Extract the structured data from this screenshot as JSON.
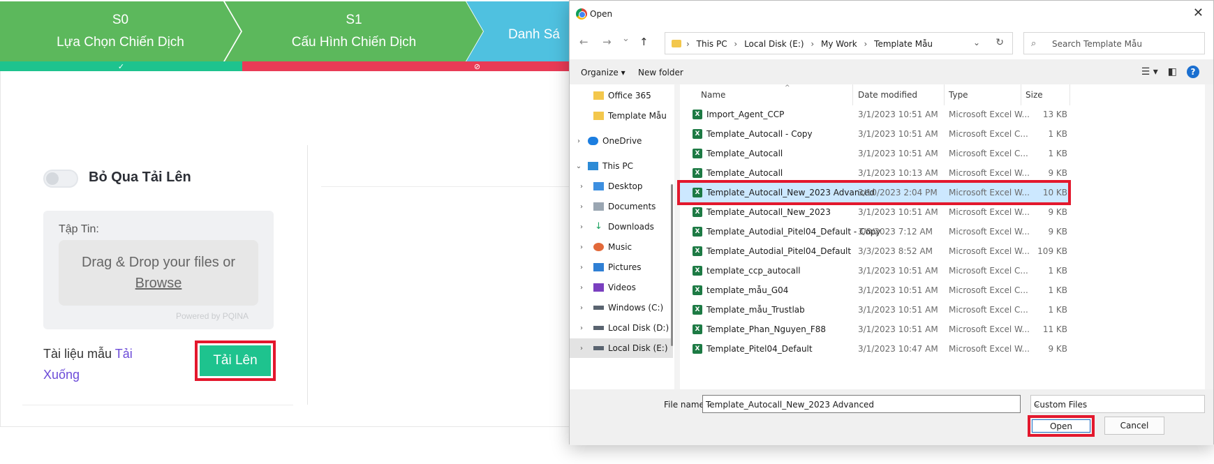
{
  "wizard": {
    "steps": [
      {
        "code": "S0",
        "label": "Lựa Chọn Chiến Dịch"
      },
      {
        "code": "S1",
        "label": "Cấu Hình Chiến Dịch"
      },
      {
        "code": "",
        "label": "Danh Sá"
      }
    ],
    "progress_ok_icon": "✓",
    "progress_bad_icon": "⊘",
    "colors": {
      "green": "#5cb85c",
      "blue": "#4fc1e0",
      "ok_bar": "#1ec38e",
      "bad_bar": "#e93b56"
    }
  },
  "upload_panel": {
    "skip_label": "Bỏ Qua Tải Lên",
    "file_label": "Tập Tin:",
    "drop_text": "Drag & Drop your files or",
    "browse": "Browse",
    "powered": "Powered by PQINA",
    "sample_text": "Tài liệu mẫu",
    "sample_link_1": "Tải",
    "sample_link_2": "Xuống",
    "upload_button": "Tải Lên"
  },
  "dialog": {
    "title": "Open",
    "close": "✕",
    "nav": {
      "back": "←",
      "forward": "→",
      "recent": "⌄",
      "up": "↑"
    },
    "breadcrumbs": [
      "This PC",
      "Local Disk (E:)",
      "My Work",
      "Template Mẫu"
    ],
    "search_placeholder": "Search Template Mẫu",
    "toolbar": {
      "organize": "Organize ▾",
      "new_folder": "New folder"
    },
    "nav_pane": [
      {
        "label": "Office 365",
        "icon": "folder-icon"
      },
      {
        "label": "Template Mẫu",
        "icon": "folder-icon"
      },
      {
        "label": "OneDrive",
        "icon": "cloud-icon"
      },
      {
        "label": "This PC",
        "icon": "pc-icon"
      },
      {
        "label": "Desktop",
        "icon": "desktop-icon"
      },
      {
        "label": "Documents",
        "icon": "documents-icon"
      },
      {
        "label": "Downloads",
        "icon": "download-icon"
      },
      {
        "label": "Music",
        "icon": "music-icon"
      },
      {
        "label": "Pictures",
        "icon": "pictures-icon"
      },
      {
        "label": "Videos",
        "icon": "videos-icon"
      },
      {
        "label": "Windows (C:)",
        "icon": "drive-icon"
      },
      {
        "label": "Local Disk (D:)",
        "icon": "drive-icon"
      },
      {
        "label": "Local Disk (E:)",
        "icon": "drive-icon"
      }
    ],
    "columns": {
      "name": "Name",
      "date": "Date modified",
      "type": "Type",
      "size": "Size"
    },
    "files": [
      {
        "name": "Import_Agent_CCP",
        "date": "3/1/2023 10:51 AM",
        "type": "Microsoft Excel W...",
        "size": "13 KB"
      },
      {
        "name": "Template_Autocall - Copy",
        "date": "3/1/2023 10:51 AM",
        "type": "Microsoft Excel C...",
        "size": "1 KB"
      },
      {
        "name": "Template_Autocall",
        "date": "3/1/2023 10:51 AM",
        "type": "Microsoft Excel C...",
        "size": "1 KB"
      },
      {
        "name": "Template_Autocall",
        "date": "3/1/2023 10:13 AM",
        "type": "Microsoft Excel W...",
        "size": "9 KB"
      },
      {
        "name": "Template_Autocall_New_2023 Advanced",
        "date": "3/10/2023 2:04 PM",
        "type": "Microsoft Excel W...",
        "size": "10 KB"
      },
      {
        "name": "Template_Autocall_New_2023",
        "date": "3/1/2023 10:51 AM",
        "type": "Microsoft Excel W...",
        "size": "9 KB"
      },
      {
        "name": "Template_Autodial_Pitel04_Default - Copy",
        "date": "3/8/2023 7:12 AM",
        "type": "Microsoft Excel W...",
        "size": "9 KB"
      },
      {
        "name": "Template_Autodial_Pitel04_Default",
        "date": "3/3/2023 8:52 AM",
        "type": "Microsoft Excel W...",
        "size": "109 KB"
      },
      {
        "name": "template_ccp_autocall",
        "date": "3/1/2023 10:51 AM",
        "type": "Microsoft Excel C...",
        "size": "1 KB"
      },
      {
        "name": "template_mẫu_G04",
        "date": "3/1/2023 10:51 AM",
        "type": "Microsoft Excel C...",
        "size": "1 KB"
      },
      {
        "name": "Template_mẫu_Trustlab",
        "date": "3/1/2023 10:51 AM",
        "type": "Microsoft Excel C...",
        "size": "1 KB"
      },
      {
        "name": "Template_Phan_Nguyen_F88",
        "date": "3/1/2023 10:51 AM",
        "type": "Microsoft Excel W...",
        "size": "11 KB"
      },
      {
        "name": "Template_Pitel04_Default",
        "date": "3/1/2023 10:47 AM",
        "type": "Microsoft Excel W...",
        "size": "9 KB"
      }
    ],
    "selected_index": 4,
    "file_name_label": "File name:",
    "file_name_value": "Template_Autocall_New_2023 Advanced",
    "file_type": "Custom Files",
    "open_button": "Open",
    "cancel_button": "Cancel"
  }
}
